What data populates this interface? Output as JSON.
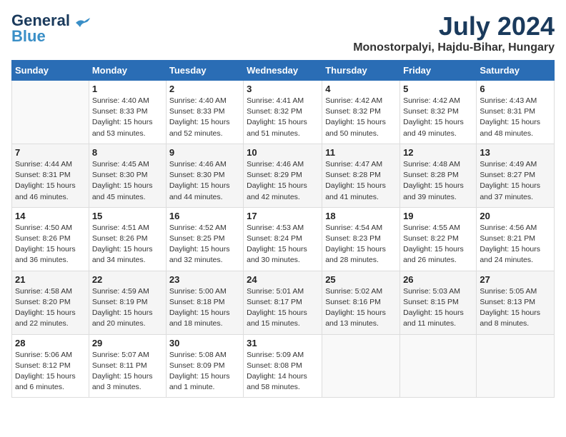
{
  "header": {
    "logo_line1": "General",
    "logo_line2": "Blue",
    "month_title": "July 2024",
    "subtitle": "Monostorpalyi, Hajdu-Bihar, Hungary"
  },
  "days_of_week": [
    "Sunday",
    "Monday",
    "Tuesday",
    "Wednesday",
    "Thursday",
    "Friday",
    "Saturday"
  ],
  "weeks": [
    [
      {
        "day": "",
        "info": ""
      },
      {
        "day": "1",
        "info": "Sunrise: 4:40 AM\nSunset: 8:33 PM\nDaylight: 15 hours\nand 53 minutes."
      },
      {
        "day": "2",
        "info": "Sunrise: 4:40 AM\nSunset: 8:33 PM\nDaylight: 15 hours\nand 52 minutes."
      },
      {
        "day": "3",
        "info": "Sunrise: 4:41 AM\nSunset: 8:32 PM\nDaylight: 15 hours\nand 51 minutes."
      },
      {
        "day": "4",
        "info": "Sunrise: 4:42 AM\nSunset: 8:32 PM\nDaylight: 15 hours\nand 50 minutes."
      },
      {
        "day": "5",
        "info": "Sunrise: 4:42 AM\nSunset: 8:32 PM\nDaylight: 15 hours\nand 49 minutes."
      },
      {
        "day": "6",
        "info": "Sunrise: 4:43 AM\nSunset: 8:31 PM\nDaylight: 15 hours\nand 48 minutes."
      }
    ],
    [
      {
        "day": "7",
        "info": "Sunrise: 4:44 AM\nSunset: 8:31 PM\nDaylight: 15 hours\nand 46 minutes."
      },
      {
        "day": "8",
        "info": "Sunrise: 4:45 AM\nSunset: 8:30 PM\nDaylight: 15 hours\nand 45 minutes."
      },
      {
        "day": "9",
        "info": "Sunrise: 4:46 AM\nSunset: 8:30 PM\nDaylight: 15 hours\nand 44 minutes."
      },
      {
        "day": "10",
        "info": "Sunrise: 4:46 AM\nSunset: 8:29 PM\nDaylight: 15 hours\nand 42 minutes."
      },
      {
        "day": "11",
        "info": "Sunrise: 4:47 AM\nSunset: 8:28 PM\nDaylight: 15 hours\nand 41 minutes."
      },
      {
        "day": "12",
        "info": "Sunrise: 4:48 AM\nSunset: 8:28 PM\nDaylight: 15 hours\nand 39 minutes."
      },
      {
        "day": "13",
        "info": "Sunrise: 4:49 AM\nSunset: 8:27 PM\nDaylight: 15 hours\nand 37 minutes."
      }
    ],
    [
      {
        "day": "14",
        "info": "Sunrise: 4:50 AM\nSunset: 8:26 PM\nDaylight: 15 hours\nand 36 minutes."
      },
      {
        "day": "15",
        "info": "Sunrise: 4:51 AM\nSunset: 8:26 PM\nDaylight: 15 hours\nand 34 minutes."
      },
      {
        "day": "16",
        "info": "Sunrise: 4:52 AM\nSunset: 8:25 PM\nDaylight: 15 hours\nand 32 minutes."
      },
      {
        "day": "17",
        "info": "Sunrise: 4:53 AM\nSunset: 8:24 PM\nDaylight: 15 hours\nand 30 minutes."
      },
      {
        "day": "18",
        "info": "Sunrise: 4:54 AM\nSunset: 8:23 PM\nDaylight: 15 hours\nand 28 minutes."
      },
      {
        "day": "19",
        "info": "Sunrise: 4:55 AM\nSunset: 8:22 PM\nDaylight: 15 hours\nand 26 minutes."
      },
      {
        "day": "20",
        "info": "Sunrise: 4:56 AM\nSunset: 8:21 PM\nDaylight: 15 hours\nand 24 minutes."
      }
    ],
    [
      {
        "day": "21",
        "info": "Sunrise: 4:58 AM\nSunset: 8:20 PM\nDaylight: 15 hours\nand 22 minutes."
      },
      {
        "day": "22",
        "info": "Sunrise: 4:59 AM\nSunset: 8:19 PM\nDaylight: 15 hours\nand 20 minutes."
      },
      {
        "day": "23",
        "info": "Sunrise: 5:00 AM\nSunset: 8:18 PM\nDaylight: 15 hours\nand 18 minutes."
      },
      {
        "day": "24",
        "info": "Sunrise: 5:01 AM\nSunset: 8:17 PM\nDaylight: 15 hours\nand 15 minutes."
      },
      {
        "day": "25",
        "info": "Sunrise: 5:02 AM\nSunset: 8:16 PM\nDaylight: 15 hours\nand 13 minutes."
      },
      {
        "day": "26",
        "info": "Sunrise: 5:03 AM\nSunset: 8:15 PM\nDaylight: 15 hours\nand 11 minutes."
      },
      {
        "day": "27",
        "info": "Sunrise: 5:05 AM\nSunset: 8:13 PM\nDaylight: 15 hours\nand 8 minutes."
      }
    ],
    [
      {
        "day": "28",
        "info": "Sunrise: 5:06 AM\nSunset: 8:12 PM\nDaylight: 15 hours\nand 6 minutes."
      },
      {
        "day": "29",
        "info": "Sunrise: 5:07 AM\nSunset: 8:11 PM\nDaylight: 15 hours\nand 3 minutes."
      },
      {
        "day": "30",
        "info": "Sunrise: 5:08 AM\nSunset: 8:09 PM\nDaylight: 15 hours\nand 1 minute."
      },
      {
        "day": "31",
        "info": "Sunrise: 5:09 AM\nSunset: 8:08 PM\nDaylight: 14 hours\nand 58 minutes."
      },
      {
        "day": "",
        "info": ""
      },
      {
        "day": "",
        "info": ""
      },
      {
        "day": "",
        "info": ""
      }
    ]
  ]
}
